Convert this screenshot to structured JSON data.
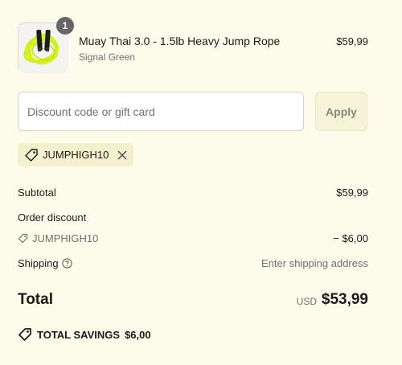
{
  "product": {
    "quantity": "1",
    "title": "Muay Thai 3.0 - 1.5lb Heavy Jump Rope",
    "variant": "Signal Green",
    "price": "$59,99",
    "image_icon": "jump-rope-image"
  },
  "discount": {
    "placeholder": "Discount code or gift card",
    "value": "",
    "apply_label": "Apply"
  },
  "applied_code": {
    "code": "JUMPHIGH10",
    "icon": "tag-icon",
    "remove_icon": "close-icon"
  },
  "summary": {
    "subtotal_label": "Subtotal",
    "subtotal_value": "$59,99",
    "order_discount_label": "Order discount",
    "discount_code": "JUMPHIGH10",
    "discount_value": "− $6,00",
    "shipping_label": "Shipping",
    "shipping_value": "Enter shipping address",
    "total_label": "Total",
    "currency": "USD",
    "total_value": "$53,99"
  },
  "savings": {
    "label": "TOTAL SAVINGS",
    "value": "$6,00"
  },
  "colors": {
    "background": "#fdfbea",
    "tag_background": "#f2f0cd",
    "rope_green": "#d4f01a",
    "muted_text": "#707070"
  }
}
